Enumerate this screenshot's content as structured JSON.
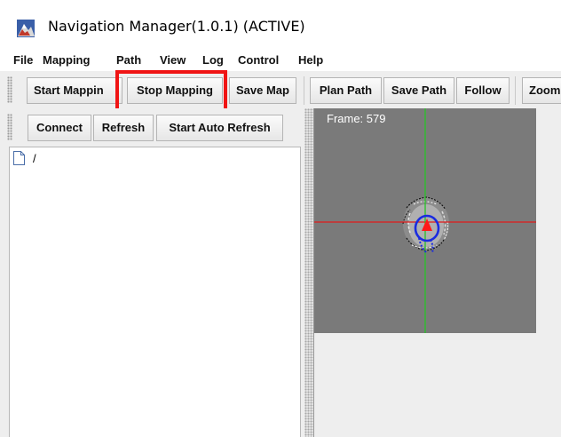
{
  "window": {
    "title": "Navigation Manager(1.0.1) (ACTIVE)",
    "icon": "app-icon"
  },
  "menu": {
    "items": [
      {
        "label": "File"
      },
      {
        "label": "Mapping"
      },
      {
        "label": "Path"
      },
      {
        "label": "View"
      },
      {
        "label": "Log"
      },
      {
        "label": "Control"
      },
      {
        "label": "Help"
      }
    ]
  },
  "toolbar": {
    "start_mapping": "Start Mappin",
    "stop_mapping": "Stop Mapping",
    "save_map": "Save Map",
    "plan_path": "Plan Path",
    "save_path": "Save Path",
    "follow": "Follow",
    "zoom": "Zoom"
  },
  "connection_toolbar": {
    "connect": "Connect",
    "refresh": "Refresh",
    "start_auto_refresh": "Start Auto Refresh"
  },
  "tree": {
    "root_label": "/",
    "root_icon": "file-icon"
  },
  "map": {
    "frame_label": "Frame: 579",
    "background_color": "#7a7a7a",
    "x_axis_color": "#e11b1b",
    "y_axis_color": "#27c427",
    "robot_color": "#ff1a1a",
    "path_color": "#1a2be0"
  },
  "highlight": {
    "color": "#f01414",
    "target": "stop-mapping-button"
  }
}
